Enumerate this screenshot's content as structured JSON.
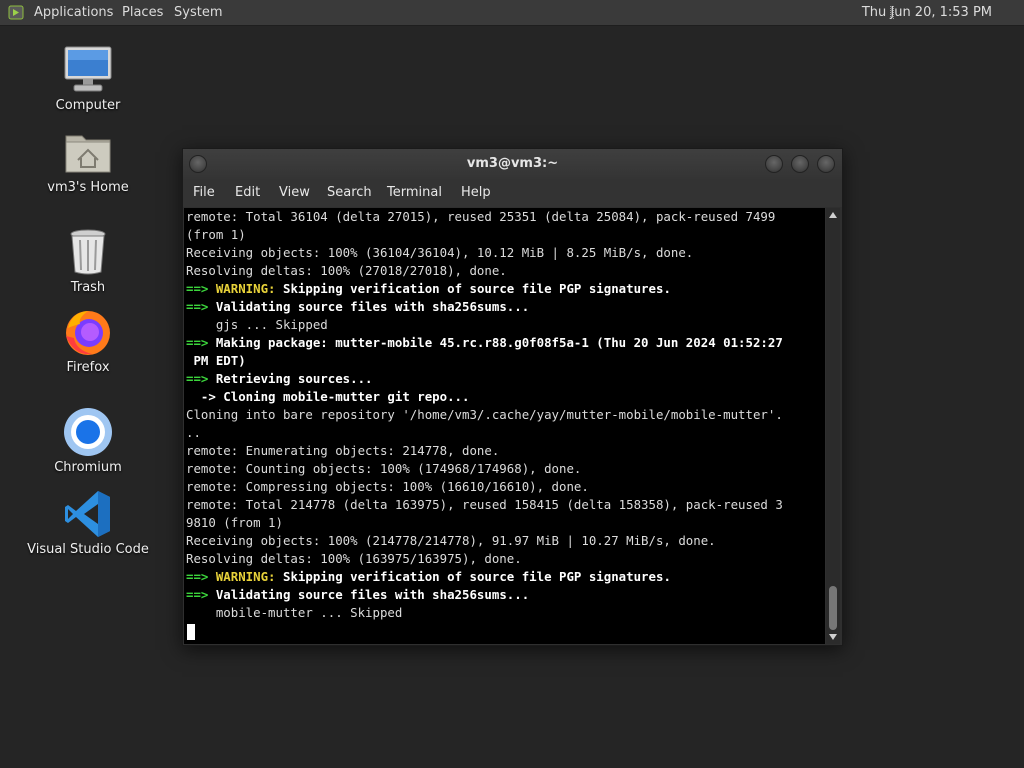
{
  "panel": {
    "menus": [
      "Applications",
      "Places",
      "System"
    ],
    "clock": "Thu Jun 20,  1:53 PM"
  },
  "desktop": {
    "icons": [
      {
        "label": "Computer",
        "icon": "computer-icon"
      },
      {
        "label": "vm3's Home",
        "icon": "home-folder-icon"
      },
      {
        "label": "Trash",
        "icon": "trash-icon"
      },
      {
        "label": "Firefox",
        "icon": "firefox-icon"
      },
      {
        "label": "Chromium",
        "icon": "chromium-icon"
      },
      {
        "label": "Visual Studio Code",
        "icon": "vscode-icon"
      }
    ]
  },
  "terminal": {
    "title": "vm3@vm3:~",
    "menu": [
      "File",
      "Edit",
      "View",
      "Search",
      "Terminal",
      "Help"
    ],
    "lines": [
      [
        {
          "t": "remote: Total 36104 (delta 27015), reused 25351 (delta 25084), pack-reused 7499"
        }
      ],
      [
        {
          "t": "(from 1)"
        }
      ],
      [
        {
          "t": "Receiving objects: 100% (36104/36104), 10.12 MiB | 8.25 MiB/s, done."
        }
      ],
      [
        {
          "t": "Resolving deltas: 100% (27018/27018), done."
        }
      ],
      [
        {
          "t": "==> ",
          "c": "g"
        },
        {
          "t": "WARNING:",
          "c": "y"
        },
        {
          "t": " Skipping verification of source file PGP signatures.",
          "c": "w"
        }
      ],
      [
        {
          "t": "==> ",
          "c": "g"
        },
        {
          "t": "Validating source files with sha256sums...",
          "c": "w"
        }
      ],
      [
        {
          "t": "    gjs ... Skipped"
        }
      ],
      [
        {
          "t": "==> ",
          "c": "g"
        },
        {
          "t": "Making package: mutter-mobile 45.rc.r88.g0f08f5a-1 (Thu 20 Jun 2024 01:52:27",
          "c": "w"
        }
      ],
      [
        {
          "t": " PM EDT)",
          "c": "w"
        }
      ],
      [
        {
          "t": "==> ",
          "c": "g"
        },
        {
          "t": "Retrieving sources...",
          "c": "w"
        }
      ],
      [
        {
          "t": "  -> Cloning mobile-mutter git repo...",
          "c": "w"
        }
      ],
      [
        {
          "t": "Cloning into bare repository '/home/vm3/.cache/yay/mutter-mobile/mobile-mutter'."
        }
      ],
      [
        {
          "t": ".."
        }
      ],
      [
        {
          "t": "remote: Enumerating objects: 214778, done."
        }
      ],
      [
        {
          "t": "remote: Counting objects: 100% (174968/174968), done."
        }
      ],
      [
        {
          "t": "remote: Compressing objects: 100% (16610/16610), done."
        }
      ],
      [
        {
          "t": "remote: Total 214778 (delta 163975), reused 158415 (delta 158358), pack-reused 3"
        }
      ],
      [
        {
          "t": "9810 (from 1)"
        }
      ],
      [
        {
          "t": "Receiving objects: 100% (214778/214778), 91.97 MiB | 10.27 MiB/s, done."
        }
      ],
      [
        {
          "t": "Resolving deltas: 100% (163975/163975), done."
        }
      ],
      [
        {
          "t": "==> ",
          "c": "g"
        },
        {
          "t": "WARNING:",
          "c": "y"
        },
        {
          "t": " Skipping verification of source file PGP signatures.",
          "c": "w"
        }
      ],
      [
        {
          "t": "==> ",
          "c": "g"
        },
        {
          "t": "Validating source files with sha256sums...",
          "c": "w"
        }
      ],
      [
        {
          "t": "    mobile-mutter ... Skipped"
        }
      ]
    ]
  },
  "colors": {
    "desktop_bg": "#252525",
    "prompt_arrow": "#3cd63c",
    "warning": "#e8d23a"
  }
}
